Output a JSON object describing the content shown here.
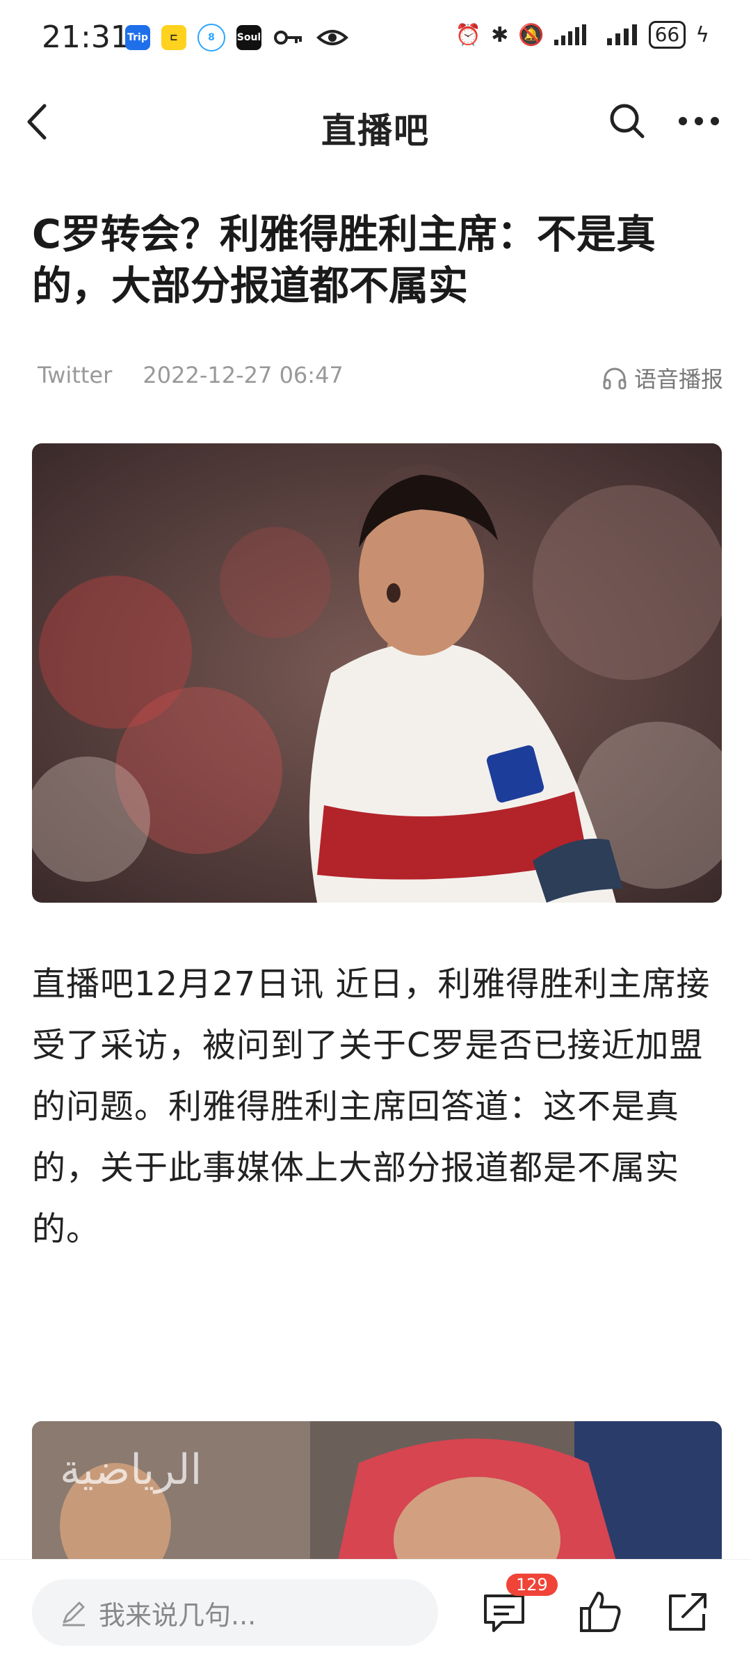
{
  "status_bar": {
    "time": "21:31",
    "app_icons": [
      "Trip",
      "⊏",
      "8",
      "Soul"
    ],
    "battery": "66"
  },
  "nav": {
    "title": "直播吧"
  },
  "article": {
    "headline": "C罗转会？利雅得胜利主席：不是真的，大部分报道都不属实",
    "source": "Twitter",
    "datetime": "2022-12-27 06:47",
    "audio_label": "语音播报",
    "body": "直播吧12月27日讯 近日，利雅得胜利主席接受了采访，被问到了关于C罗是否已接近加盟的问题。利雅得胜利主席回答道：这不是真的，关于此事媒体上大部分报道都是不属实的。"
  },
  "bottom_bar": {
    "comment_placeholder": "我来说几句...",
    "comment_count": "129"
  },
  "colors": {
    "accent_red": "#f04438",
    "text_dark": "#222222",
    "meta_gray": "#999999"
  }
}
